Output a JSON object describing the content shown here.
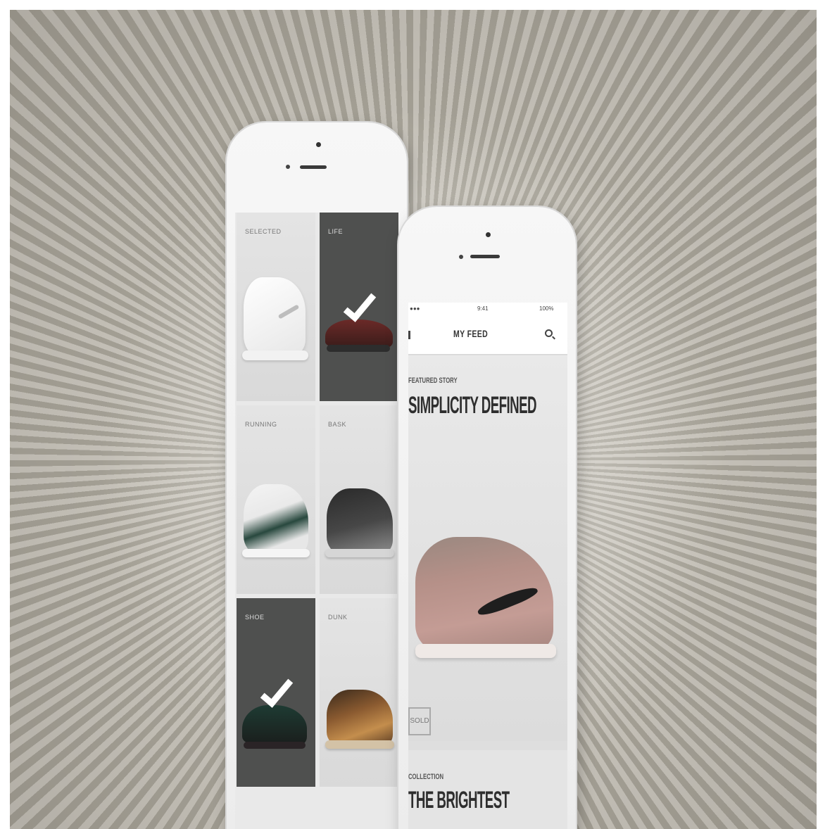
{
  "grid_tiles": [
    {
      "tag": "SELECTED",
      "selected": false,
      "theme": "light"
    },
    {
      "tag": "LIFE",
      "selected": true,
      "theme": "dark"
    },
    {
      "tag": "RUNNING",
      "selected": false,
      "theme": "light"
    },
    {
      "tag": "BASK",
      "selected": false,
      "theme": "light"
    },
    {
      "tag": "SHOE",
      "selected": true,
      "theme": "dark"
    },
    {
      "tag": "DUNK",
      "selected": false,
      "theme": "light"
    }
  ],
  "feed": {
    "status_left": "●●●",
    "status_center": "9:41",
    "status_right": "100%",
    "nav_title": "MY FEED",
    "story1_kicker": "FEATURED STORY",
    "story1_headline": "SIMPLICITY DEFINED",
    "story1_badge": "SOLD",
    "story2_kicker": "COLLECTION",
    "story2_headline": "THE BRIGHTEST"
  },
  "colors": {
    "dark_tile": "#4f504f",
    "check": "#ffffff",
    "accent_shoe": "#b08a84"
  }
}
